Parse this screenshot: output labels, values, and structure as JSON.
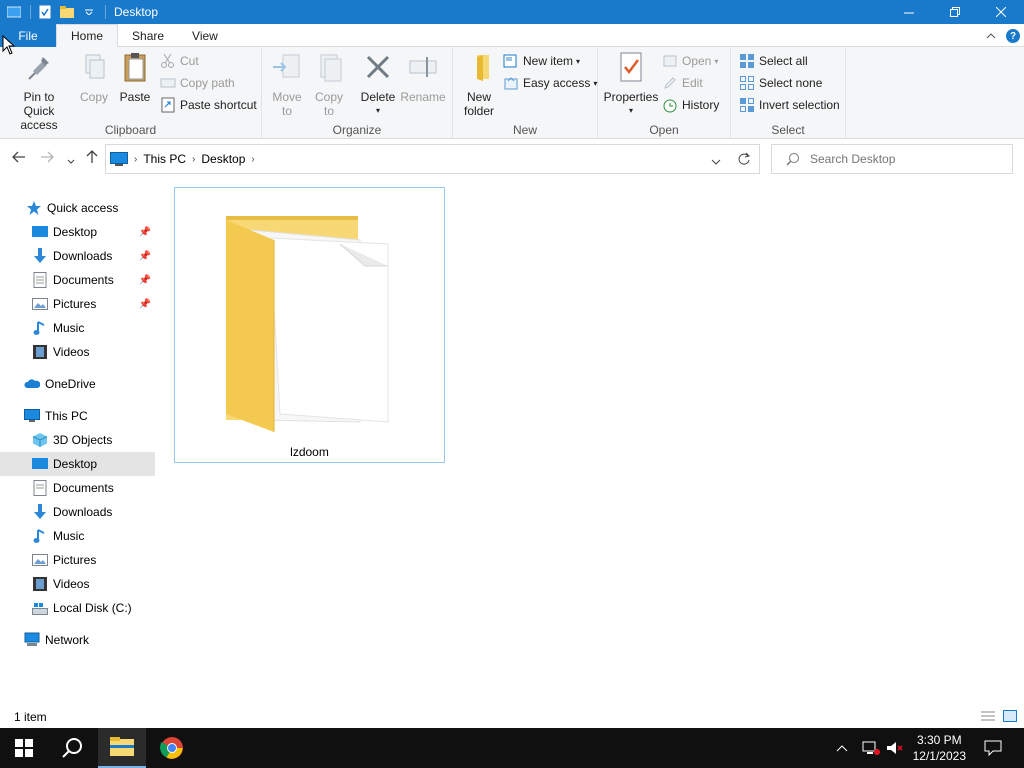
{
  "window": {
    "title": "Desktop",
    "minimize_icon": "minimize-icon",
    "maximize_icon": "restore-icon",
    "close_icon": "close-icon"
  },
  "tabs": {
    "file": "File",
    "home": "Home",
    "share": "Share",
    "view": "View"
  },
  "ribbon": {
    "clipboard": {
      "label": "Clipboard",
      "pin": "Pin to Quick access",
      "copy": "Copy",
      "paste": "Paste",
      "cut": "Cut",
      "copy_path": "Copy path",
      "paste_shortcut": "Paste shortcut"
    },
    "organize": {
      "label": "Organize",
      "move_to": "Move to",
      "copy_to": "Copy to",
      "delete": "Delete",
      "rename": "Rename"
    },
    "new": {
      "label": "New",
      "new_folder": "New folder",
      "new_item": "New item",
      "easy_access": "Easy access"
    },
    "open": {
      "label": "Open",
      "properties": "Properties",
      "open": "Open",
      "edit": "Edit",
      "history": "History"
    },
    "select": {
      "label": "Select",
      "select_all": "Select all",
      "select_none": "Select none",
      "invert": "Invert selection"
    }
  },
  "address": {
    "crumbs": [
      "This PC",
      "Desktop"
    ],
    "search_placeholder": "Search Desktop"
  },
  "nav": {
    "quick_access": "Quick access",
    "qa_items": [
      "Desktop",
      "Downloads",
      "Documents",
      "Pictures",
      "Music",
      "Videos"
    ],
    "onedrive": "OneDrive",
    "this_pc": "This PC",
    "pc_items": [
      "3D Objects",
      "Desktop",
      "Documents",
      "Downloads",
      "Music",
      "Pictures",
      "Videos",
      "Local Disk (C:)"
    ],
    "network": "Network"
  },
  "content": {
    "items": [
      {
        "name": "lzdoom",
        "type": "folder"
      }
    ]
  },
  "status": {
    "count": "1 item"
  },
  "taskbar": {
    "time": "3:30 PM",
    "date": "12/1/2023"
  },
  "colors": {
    "accent": "#1979ca",
    "ribbon_bg": "#f5f6f7",
    "folder_yellow": "#f8d775",
    "selection": "#99c9ef"
  }
}
